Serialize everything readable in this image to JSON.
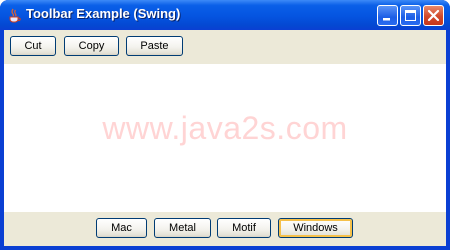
{
  "window": {
    "title": "Toolbar Example (Swing)",
    "controls": [
      "minimize",
      "maximize",
      "close"
    ]
  },
  "toolbar_top": {
    "buttons": [
      "Cut",
      "Copy",
      "Paste"
    ]
  },
  "content": {
    "watermark": "www.java2s.com"
  },
  "toolbar_bottom": {
    "buttons": [
      "Mac",
      "Metal",
      "Motif",
      "Windows"
    ],
    "focused": "Windows"
  },
  "colors": {
    "titlebar": "#0554e0",
    "panel": "#ece9d8",
    "watermark": "#ffd4d4",
    "close_button": "#d1492b"
  }
}
